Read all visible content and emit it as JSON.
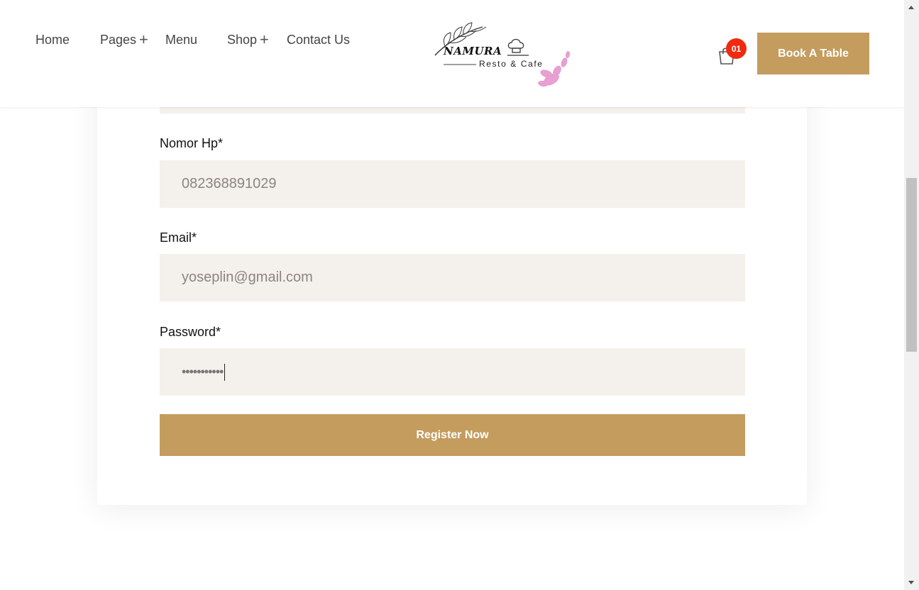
{
  "nav": {
    "items": [
      {
        "label": "Home",
        "has_submenu": false
      },
      {
        "label": "Pages",
        "has_submenu": true
      },
      {
        "label": "Menu",
        "has_submenu": false
      },
      {
        "label": "Shop",
        "has_submenu": true
      },
      {
        "label": "Contact Us",
        "has_submenu": false
      }
    ],
    "submenu_icon": "+"
  },
  "logo": {
    "title": "NAMURA",
    "subtitle": "Resto & Cafe"
  },
  "cart": {
    "count": "01",
    "icon": "shopping-bag-icon"
  },
  "book_button": {
    "label": "Book A Table"
  },
  "form": {
    "phone": {
      "label": "Nomor Hp*",
      "value": "082368891029"
    },
    "email": {
      "label": "Email*",
      "value": "yoseplin@gmail.com"
    },
    "password": {
      "label": "Password*",
      "masked_value": "•••••••••••"
    },
    "register_label": "Register Now"
  },
  "colors": {
    "accent": "#c49c5e",
    "badge": "#f02a0f",
    "field_bg": "#f4f0ec"
  }
}
